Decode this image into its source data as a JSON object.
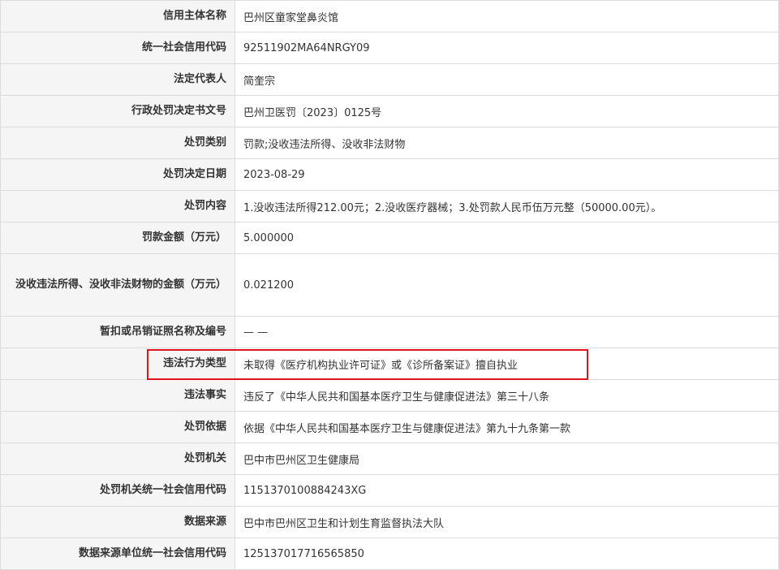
{
  "rows": [
    {
      "label": "信用主体名称",
      "value": "巴州区童家堂鼻炎馆"
    },
    {
      "label": "统一社会信用代码",
      "value": "92511902MA64NRGY09"
    },
    {
      "label": "法定代表人",
      "value": "简奎宗"
    },
    {
      "label": "行政处罚决定书文号",
      "value": "巴州卫医罚〔2023〕0125号"
    },
    {
      "label": "处罚类别",
      "value": "罚款;没收违法所得、没收非法财物"
    },
    {
      "label": "处罚决定日期",
      "value": "2023-08-29"
    },
    {
      "label": "处罚内容",
      "value": "1.没收违法所得212.00元；2.没收医疗器械；3.处罚款人民币伍万元整（50000.00元）。"
    },
    {
      "label": "罚款金额（万元）",
      "value": "5.000000"
    },
    {
      "label": "没收违法所得、没收非法财物的金额（万元）",
      "value": "0.021200"
    },
    {
      "label": "暂扣或吊销证照名称及编号",
      "value": "— —"
    },
    {
      "label": "违法行为类型",
      "value": "未取得《医疗机构执业许可证》或《诊所备案证》擅自执业"
    },
    {
      "label": "违法事实",
      "value": "违反了《中华人民共和国基本医疗卫生与健康促进法》第三十八条"
    },
    {
      "label": "处罚依据",
      "value": "依据《中华人民共和国基本医疗卫生与健康促进法》第九十九条第一款"
    },
    {
      "label": "处罚机关",
      "value": "巴中市巴州区卫生健康局"
    },
    {
      "label": "处罚机关统一社会信用代码",
      "value": "1151370100884243XG"
    },
    {
      "label": "数据来源",
      "value": "巴中市巴州区卫生和计划生育监督执法大队"
    },
    {
      "label": "数据来源单位统一社会信用代码",
      "value": "125137017716565850"
    }
  ],
  "colors": {
    "label_bg": "#f5f5f5",
    "border": "#dcdcdc",
    "highlight": "#e0151b"
  }
}
